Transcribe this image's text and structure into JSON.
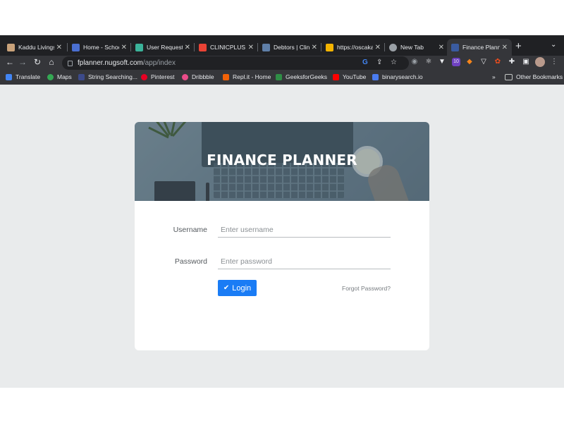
{
  "browser": {
    "tabs": [
      {
        "label": "Kaddu Livings",
        "active": false,
        "favicon_color": "#c9a27a"
      },
      {
        "label": "Home - Schoo",
        "active": false,
        "favicon_color": "#4a6fd1"
      },
      {
        "label": "User Request",
        "active": false,
        "favicon_color": "#3bb39a"
      },
      {
        "label": "CLINICPLUS C",
        "active": false,
        "favicon_color": "#ea4335"
      },
      {
        "label": "Debtors | Clin",
        "active": false,
        "favicon_color": "#5f7fa8"
      },
      {
        "label": "https://oscaka",
        "active": false,
        "favicon_color": "#f4b400"
      },
      {
        "label": "New Tab",
        "active": false,
        "favicon_color": "#9aa0a6"
      },
      {
        "label": "Finance Plann",
        "active": true,
        "favicon_color": "#3a5ba0"
      }
    ],
    "new_tab_symbol": "+",
    "tab_close_symbol": "✕",
    "url_host": "fplanner.nugsoft.com",
    "url_path": "/app/index",
    "extension_badge": "10",
    "bookmarks": [
      {
        "label": "Translate",
        "icon_color": "#4285f4"
      },
      {
        "label": "Maps",
        "icon_color": "#34a853"
      },
      {
        "label": "String Searching...",
        "icon_color": "#3c4a8a"
      },
      {
        "label": "Pinterest",
        "icon_color": "#e60023"
      },
      {
        "label": "Dribbble",
        "icon_color": "#ea4c89"
      },
      {
        "label": "Repl.it - Home",
        "icon_color": "#f26207"
      },
      {
        "label": "GeeksforGeeks",
        "icon_color": "#2f8d46"
      },
      {
        "label": "YouTube",
        "icon_color": "#ff0000"
      },
      {
        "label": "binarysearch.io",
        "icon_color": "#4a7cf0"
      }
    ],
    "bookmarks_overflow": "»",
    "other_bookmarks": "Other Bookmarks"
  },
  "login": {
    "title": "FINANCE PLANNER",
    "username_label": "Username",
    "username_placeholder": "Enter username",
    "username_value": "",
    "password_label": "Password",
    "password_placeholder": "Enter password",
    "password_value": "",
    "login_label": "Login",
    "forgot_label": "Forgot Password?"
  },
  "colors": {
    "accent": "#1a7cf5",
    "page_background": "#e9ebec",
    "chrome_dark": "#202124"
  }
}
